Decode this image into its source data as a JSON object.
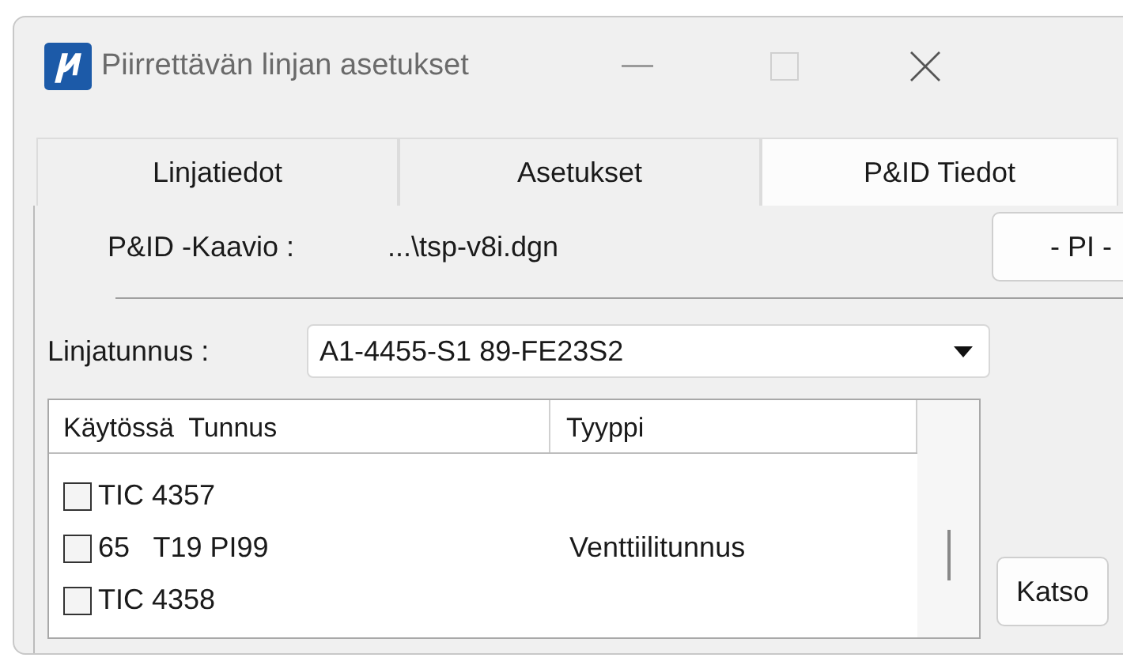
{
  "window": {
    "title": "Piirrettävän linjan asetukset"
  },
  "tabs": [
    {
      "label": "Linjatiedot",
      "selected": false
    },
    {
      "label": "Asetukset",
      "selected": false
    },
    {
      "label": "P&ID Tiedot",
      "selected": true
    }
  ],
  "diagram": {
    "label": "P&ID -Kaavio :",
    "value": "...\\tsp-v8i.dgn",
    "button": "- PI -"
  },
  "line_id": {
    "label": "Linjatunnus :",
    "value": "A1-4455-S1 89-FE23S2"
  },
  "table": {
    "columns": [
      "Käytössä  Tunnus",
      "Tyyppi"
    ],
    "rows": [
      {
        "checked": false,
        "tunnus": "TIC 4357"
      },
      {
        "checked": false,
        "tunnus": "65   T19 PI99",
        "tyyppi": "Venttiilitunnus"
      },
      {
        "checked": false,
        "tunnus": "TIC 4358"
      }
    ]
  },
  "buttons": [
    "Katso"
  ]
}
